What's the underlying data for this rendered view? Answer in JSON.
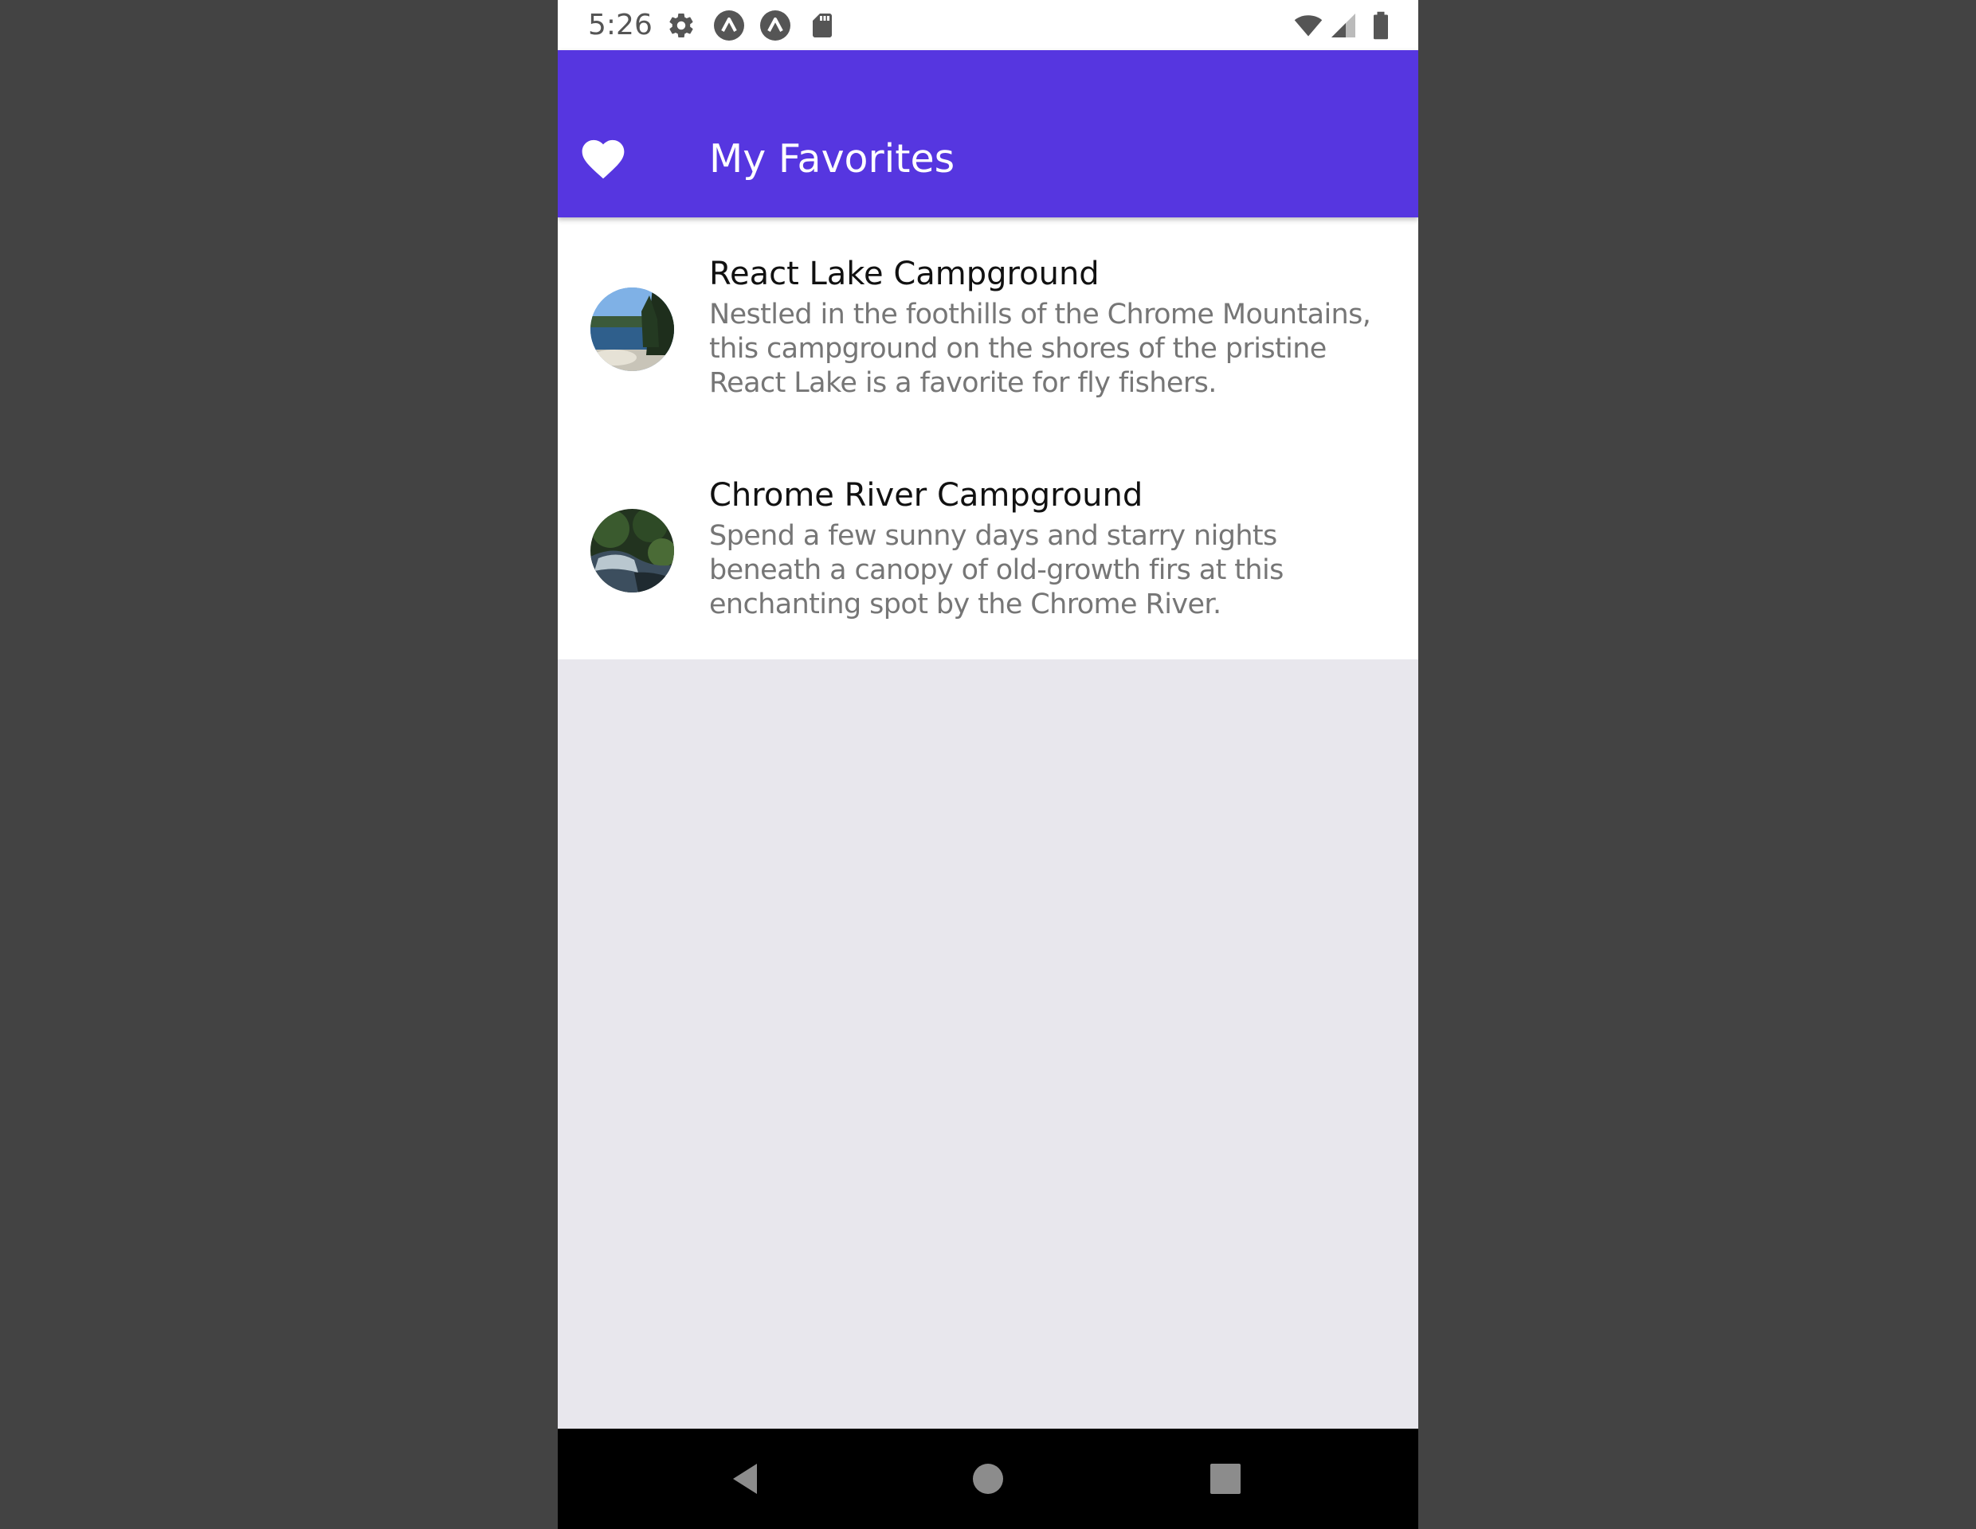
{
  "status_bar": {
    "time": "5:26",
    "icons_left": [
      "gear-icon",
      "app-notification-icon",
      "app-notification-icon",
      "sd-card-icon"
    ],
    "icons_right": [
      "wifi-icon",
      "cell-signal-icon",
      "battery-icon"
    ]
  },
  "app_bar": {
    "icon": "heart-icon",
    "title": "My Favorites",
    "background": "#5636e0"
  },
  "list": {
    "items": [
      {
        "title": "React Lake Campground",
        "description": "Nestled in the foothills of the Chrome Mountains, this campground on the shores of the pristine React Lake is a favorite for fly fishers.",
        "thumbnail": "lake-thumbnail"
      },
      {
        "title": "Chrome River Campground",
        "description": "Spend a few sunny days and starry nights beneath a canopy of old-growth firs at this enchanting spot by the Chrome River.",
        "thumbnail": "river-thumbnail"
      }
    ]
  },
  "nav_bar": {
    "buttons": [
      "back-icon",
      "home-icon",
      "recents-icon"
    ]
  }
}
